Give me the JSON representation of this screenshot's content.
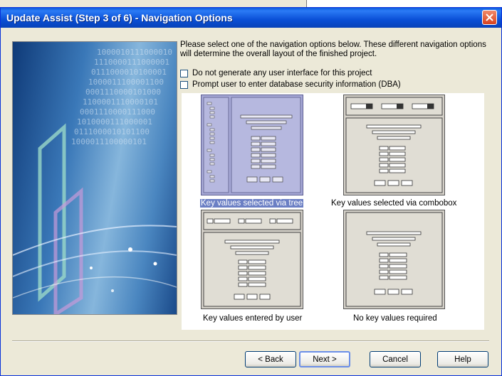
{
  "window": {
    "title": "Update Assist (Step 3 of 6) - Navigation Options"
  },
  "instructions": "Please select one of the navigation options below.  These different navigation options will determine the overall layout of the finished project.",
  "checkboxes": [
    {
      "label": "Do not generate any user interface for this project",
      "checked": false
    },
    {
      "label": "Prompt user to enter database security information (DBA)",
      "checked": false
    }
  ],
  "options": [
    {
      "label": "Key values selected via tree",
      "selected": true
    },
    {
      "label": "Key values selected via combobox",
      "selected": false
    },
    {
      "label": "Key values entered by user",
      "selected": false
    },
    {
      "label": "No key values required",
      "selected": false
    }
  ],
  "buttons": {
    "back": "< Back",
    "next": "Next >",
    "cancel": "Cancel",
    "help": "Help"
  },
  "side_art_text": [
    "1000010111000010",
    "1110000111000001",
    "0111000010100001",
    "1000011100001100",
    "0001110000101000",
    "1100001110000101",
    "0001110000111000",
    "1010000111000001",
    "0111000010101100",
    "1000011100000101"
  ],
  "colors": {
    "titlebar": "#0a4fd6",
    "selection": "#6b7fc4",
    "dialog_bg": "#ece9d8"
  }
}
